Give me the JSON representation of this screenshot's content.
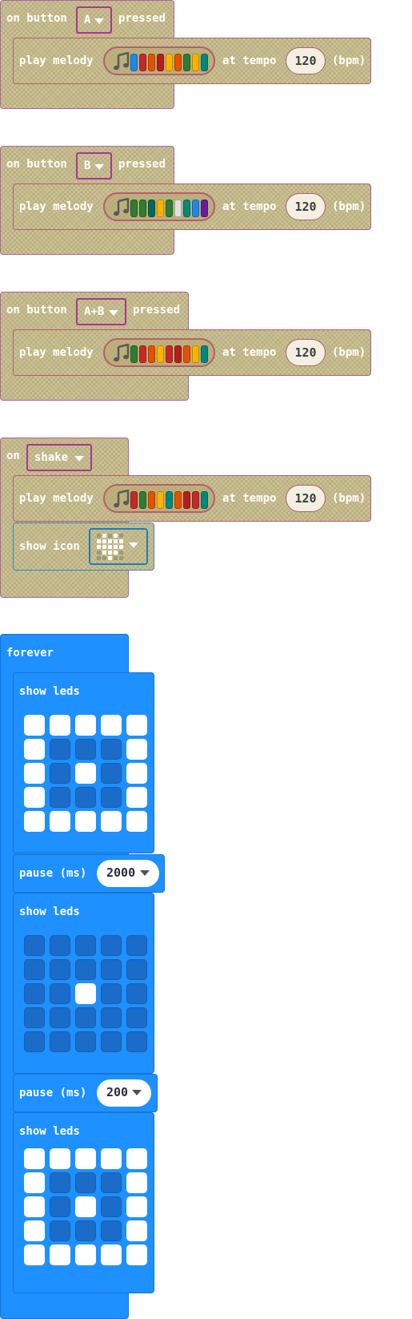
{
  "labels": {
    "on_button": "on button",
    "pressed": "pressed",
    "play_melody": "play melody",
    "at_tempo": "at tempo",
    "bpm": "(bpm)",
    "on": "on",
    "show_icon": "show icon",
    "forever": "forever",
    "show_leds": "show leds",
    "pause_ms": "pause (ms)"
  },
  "events": [
    {
      "button": "A",
      "tempo": "120",
      "notes": [
        "#1e88e5",
        "#c62828",
        "#e65100",
        "#b71c1c",
        "#ffb300",
        "#e65100",
        "#2e7d32",
        "#ffb300",
        "#00897b"
      ]
    },
    {
      "button": "B",
      "tempo": "120",
      "notes": [
        "#2e7d32",
        "#2e7d32",
        "#00695c",
        "#ffb300",
        "#2e7d32",
        "#e0e0e0",
        "#00897b",
        "#1e88e5",
        "#6a1b9a"
      ]
    },
    {
      "button": "A+B",
      "tempo": "120",
      "notes": [
        "#2e7d32",
        "#c62828",
        "#e65100",
        "#ffb300",
        "#c62828",
        "#b71c1c",
        "#e65100",
        "#ffb300",
        "#00897b"
      ]
    }
  ],
  "shake": {
    "gesture": "shake",
    "tempo": "120",
    "notes": [
      "#c62828",
      "#2e7d32",
      "#e65100",
      "#ffb300",
      "#00897b",
      "#e65100",
      "#b71c1c",
      "#c62828",
      "#00897b"
    ],
    "icon": [
      [
        0,
        1,
        0,
        1,
        0
      ],
      [
        1,
        1,
        1,
        1,
        1
      ],
      [
        1,
        1,
        1,
        1,
        1
      ],
      [
        0,
        1,
        1,
        1,
        0
      ],
      [
        0,
        0,
        1,
        0,
        0
      ]
    ]
  },
  "forever": {
    "leds": [
      [
        [
          1,
          1,
          1,
          1,
          1
        ],
        [
          1,
          0,
          0,
          0,
          1
        ],
        [
          1,
          0,
          1,
          0,
          1
        ],
        [
          1,
          0,
          0,
          0,
          1
        ],
        [
          1,
          1,
          1,
          1,
          1
        ]
      ],
      [
        [
          0,
          0,
          0,
          0,
          0
        ],
        [
          0,
          0,
          0,
          0,
          0
        ],
        [
          0,
          0,
          1,
          0,
          0
        ],
        [
          0,
          0,
          0,
          0,
          0
        ],
        [
          0,
          0,
          0,
          0,
          0
        ]
      ],
      [
        [
          1,
          1,
          1,
          1,
          1
        ],
        [
          1,
          0,
          0,
          0,
          1
        ],
        [
          1,
          0,
          1,
          0,
          1
        ],
        [
          1,
          0,
          0,
          0,
          1
        ],
        [
          1,
          1,
          1,
          1,
          1
        ]
      ]
    ],
    "pauses": [
      "2000",
      "200"
    ]
  }
}
